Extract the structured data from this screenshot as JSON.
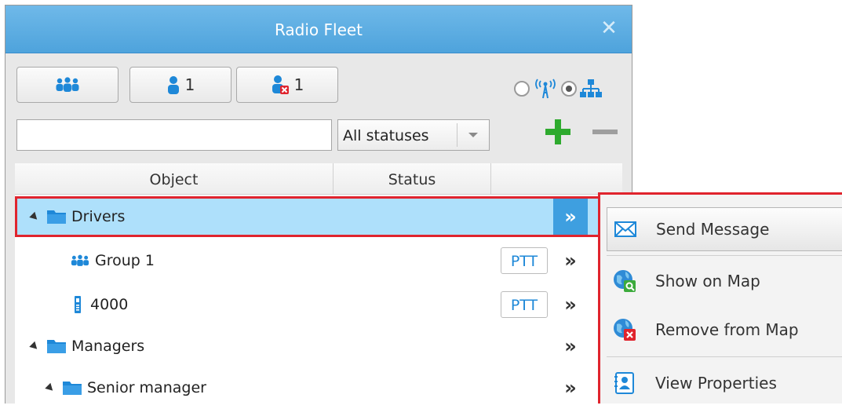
{
  "window": {
    "title": "Radio Fleet",
    "close_glyph": "✕"
  },
  "toolbar": {
    "groups_button": {
      "icon": "groups-icon"
    },
    "users_button": {
      "icon": "user-icon",
      "count": "1"
    },
    "offline_button": {
      "icon": "user-offline-icon",
      "count": "1"
    },
    "view_mode": {
      "radio_icon": "radio-tower-icon",
      "tree_icon": "hierarchy-icon",
      "selected": "tree"
    },
    "search": {
      "value": "",
      "placeholder": ""
    },
    "status_filter": {
      "selected": "All statuses"
    },
    "add_icon": "plus-icon",
    "remove_icon": "minus-icon"
  },
  "grid": {
    "columns": [
      "Object",
      "Status"
    ],
    "rows": [
      {
        "label": "Drivers",
        "type": "folder",
        "level": 0,
        "expanded": true,
        "selected": true,
        "more": "»"
      },
      {
        "label": "Group 1",
        "type": "group",
        "level": 1,
        "ptt": "PTT",
        "more": "»"
      },
      {
        "label": "4000",
        "type": "radio",
        "level": 1,
        "ptt": "PTT",
        "more": "»"
      },
      {
        "label": "Managers",
        "type": "folder",
        "level": 0,
        "expanded": true,
        "more": "»"
      },
      {
        "label": "Senior manager",
        "type": "folder",
        "level": 1,
        "expanded": true,
        "more": "»"
      }
    ]
  },
  "context_menu": {
    "items": [
      {
        "label": "Send Message",
        "icon": "envelope-icon"
      },
      {
        "label": "Show on Map",
        "icon": "globe-search-icon"
      },
      {
        "label": "Remove from Map",
        "icon": "globe-remove-icon"
      },
      {
        "label": "View Properties",
        "icon": "contact-card-icon"
      }
    ]
  },
  "colors": {
    "title_bar": "#4ea3dc",
    "selection": "#aee0fb",
    "highlight_border": "#e0242d",
    "accent": "#1e88d8",
    "add": "#2eaa2e"
  }
}
